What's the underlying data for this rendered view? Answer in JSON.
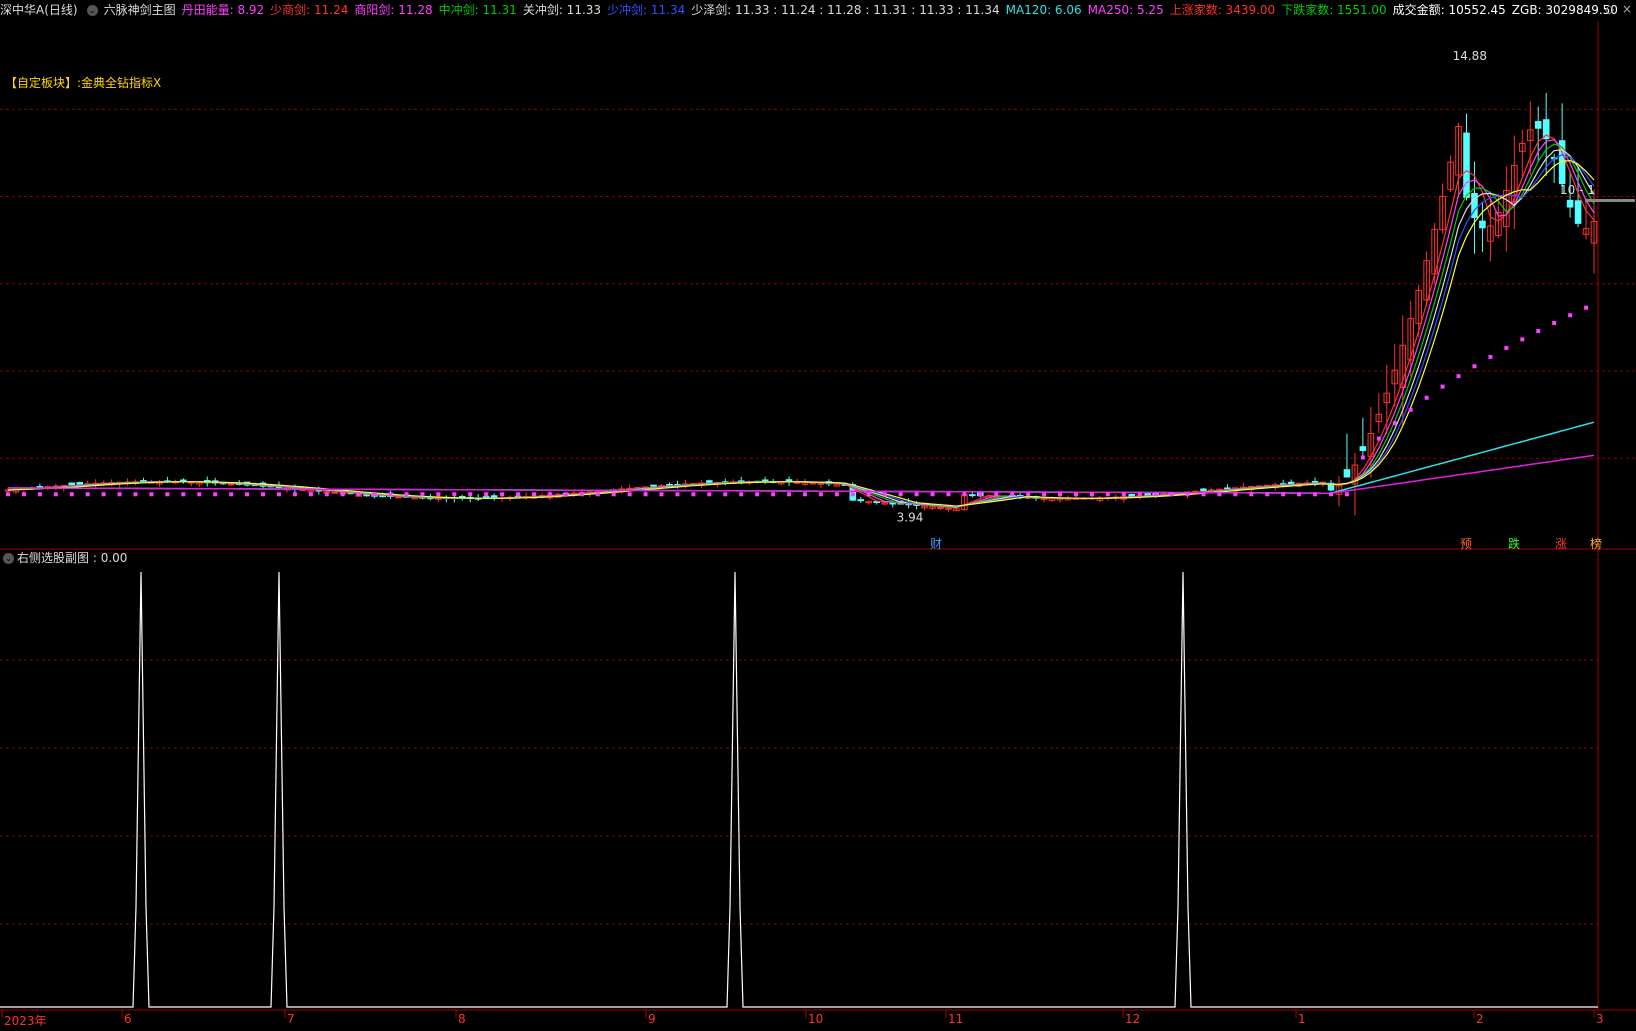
{
  "header": {
    "stock_name": "深中华A",
    "period": "(日线)",
    "indicator_name": "六脉神剑主图",
    "items": [
      {
        "label": "丹田能量:",
        "value": "8.92",
        "color": "#ff40ff"
      },
      {
        "label": "少商剑:",
        "value": "11.24",
        "color": "#ff3030"
      },
      {
        "label": "商阳剑:",
        "value": "11.28",
        "color": "#ff40ff"
      },
      {
        "label": "中冲剑:",
        "value": "11.31",
        "color": "#00cc00"
      },
      {
        "label": "关冲剑:",
        "value": "11.33",
        "color": "#dddddd"
      },
      {
        "label": "少冲剑:",
        "value": "11.34",
        "color": "#3050ff"
      },
      {
        "label": "少泽剑:",
        "value": "11.33 : 11.24 : 11.28 : 11.31 : 11.33 : 11.34",
        "color": "#dddddd"
      },
      {
        "label": "MA120:",
        "value": "6.06",
        "color": "#30e0e0"
      },
      {
        "label": "MA250:",
        "value": "5.25",
        "color": "#ff40ff"
      },
      {
        "label": "上涨家数:",
        "value": "3439.00",
        "color": "#ff3030"
      },
      {
        "label": "下跌家数:",
        "value": "1551.00",
        "color": "#00cc00"
      },
      {
        "label": "成交金额:",
        "value": "10552.45",
        "color": "#ffffff"
      },
      {
        "label": "ZGB:",
        "value": "3029849.50",
        "color": "#ffffff"
      }
    ]
  },
  "custom_block": {
    "label": "【自定板块】:",
    "value": "金典全钻指标X"
  },
  "sub_header": {
    "name": "右侧选股副图",
    "value": "0.00"
  },
  "top_icons": [
    "diamond-icon",
    "close-icon"
  ],
  "annotations": {
    "high": "14.88",
    "low": "3.94",
    "right_label": "10 - 1",
    "fin_marker": "财",
    "signals": [
      "预",
      "跌",
      "涨",
      "榜"
    ]
  },
  "colors": {
    "up": "#ff3030",
    "down": "#54ffff",
    "grid": "#8b0000",
    "ma120": "#30e0e0",
    "ma250": "#e020e0",
    "dots": "#ff40ff",
    "bg": "#000000"
  },
  "chart_data": [
    {
      "type": "candlestick",
      "title": "六脉神剑主图",
      "x_range": [
        "2023-05",
        "2024-03"
      ],
      "ylim": [
        3.5,
        15.5
      ],
      "annotated_high": 14.88,
      "annotated_low": 3.94,
      "series": [
        {
          "name": "MA120",
          "value": 6.06
        },
        {
          "name": "MA250",
          "value": 5.25
        }
      ]
    },
    {
      "type": "line",
      "title": "右侧选股副图",
      "value": 0.0,
      "spikes_at_month": [
        "6",
        "7",
        "9",
        "12"
      ],
      "ylim": [
        0,
        1
      ]
    }
  ],
  "time_axis": [
    "2023年",
    "6",
    "7",
    "8",
    "9",
    "10",
    "11",
    "12",
    "1",
    "2",
    "3"
  ]
}
